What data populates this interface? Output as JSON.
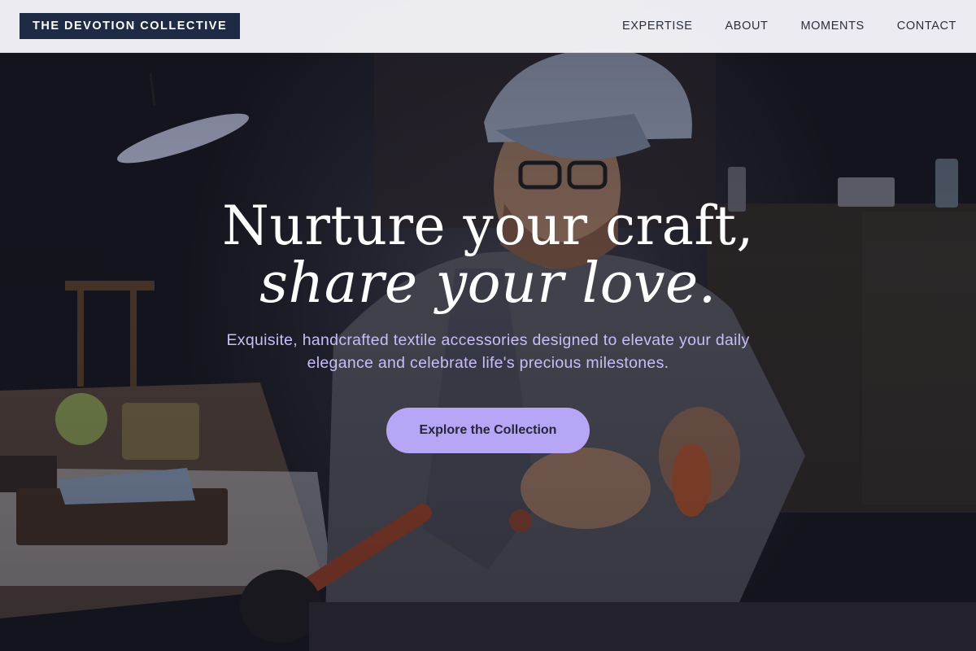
{
  "brand": {
    "label": "THE DEVOTION COLLECTIVE"
  },
  "nav": {
    "items": [
      {
        "label": "EXPERTISE"
      },
      {
        "label": "ABOUT"
      },
      {
        "label": "MOMENTS"
      },
      {
        "label": "CONTACT"
      }
    ]
  },
  "hero": {
    "headline_line1": "Nurture your craft,",
    "headline_line2": "share your love.",
    "subtitle": "Exquisite, handcrafted textile accessories designed to elevate your daily elegance and celebrate life's precious milestones.",
    "cta_label": "Explore the Collection",
    "image_subject": "craftsman in cap and glasses working at a workbench"
  },
  "colors": {
    "brand_bg": "#1f2a44",
    "accent": "#b7a6f6",
    "subtitle": "#c9bdf7",
    "nav_bg": "#f6f5fa"
  }
}
